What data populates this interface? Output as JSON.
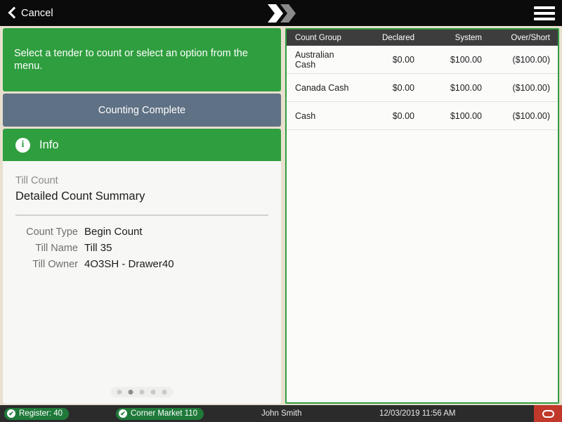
{
  "topbar": {
    "cancel_label": "Cancel",
    "back_icon": "chevron-left-icon",
    "logo_icon": "x-logo",
    "menu_icon": "hamburger-menu-icon",
    "background": "#0b0b0b"
  },
  "left": {
    "prompt": "Select a tender to count or select an option from the menu.",
    "action_button": "Counting Complete",
    "info": {
      "icon": "info-icon",
      "header": "Info",
      "glyph": "i",
      "sub_label": "Till Count",
      "title": "Detailed Count Summary",
      "fields": [
        {
          "label": "Count Type",
          "value": "Begin Count"
        },
        {
          "label": "Till Name",
          "value": "Till 35"
        },
        {
          "label": "Till Owner",
          "value": "4O3SH - Drawer40"
        }
      ],
      "pagination": {
        "count": 5,
        "active_index": 1
      }
    }
  },
  "table": {
    "columns": [
      "Count Group",
      "Declared",
      "System",
      "Over/Short"
    ],
    "rows": [
      {
        "group": "Australian Cash",
        "declared": "$0.00",
        "system": "$100.00",
        "over_short": "($100.00)"
      },
      {
        "group": "Canada Cash",
        "declared": "$0.00",
        "system": "$100.00",
        "over_short": "($100.00)"
      },
      {
        "group": "Cash",
        "declared": "$0.00",
        "system": "$100.00",
        "over_short": "($100.00)"
      }
    ]
  },
  "statusbar": {
    "register": "Register: 40",
    "store": "Corner Market 110",
    "user": "John Smith",
    "datetime": "12/03/2019 11:56 AM",
    "check_glyph": "✔",
    "power_icon": "power-button-icon"
  },
  "colors": {
    "green": "#2f9e3f",
    "slate": "#5f7184",
    "header_dark": "#3d3d3d",
    "status_green": "#1f7a3a",
    "power_red": "#c0392b",
    "page_bg": "#e8e0cf"
  }
}
